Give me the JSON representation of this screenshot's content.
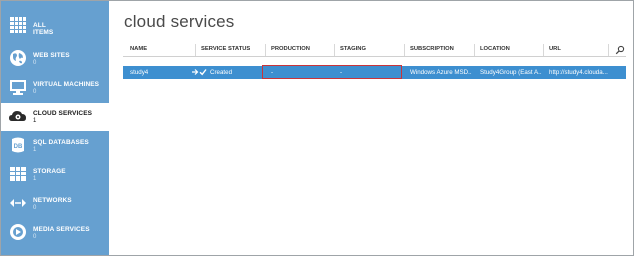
{
  "sidebar": {
    "items": [
      {
        "label": "ALL",
        "label2": "ITEMS",
        "count": "",
        "icon": "grid-icon"
      },
      {
        "label": "WEB SITES",
        "count": "0",
        "icon": "globe-icon"
      },
      {
        "label": "VIRTUAL MACHINES",
        "count": "0",
        "icon": "monitor-icon"
      },
      {
        "label": "CLOUD SERVICES",
        "count": "1",
        "icon": "cloud-gear-icon",
        "active": true
      },
      {
        "label": "SQL DATABASES",
        "count": "1",
        "icon": "database-icon"
      },
      {
        "label": "STORAGE",
        "count": "1",
        "icon": "table-icon"
      },
      {
        "label": "NETWORKS",
        "count": "0",
        "icon": "network-icon"
      },
      {
        "label": "MEDIA SERVICES",
        "count": "0",
        "icon": "media-icon"
      }
    ],
    "colors": {
      "background": "#66a0d0",
      "active": "#ffffff"
    }
  },
  "main": {
    "title": "cloud services",
    "table": {
      "columns": [
        "NAME",
        "SERVICE STATUS",
        "PRODUCTION",
        "STAGING",
        "SUBSCRIPTION",
        "LOCATION",
        "URL"
      ],
      "rows": [
        {
          "name": "study4",
          "status": "Created",
          "production": "-",
          "staging": "-",
          "subscription": "Windows Azure MSD...",
          "location": "Study4Group (East A...",
          "url": "http://study4.clouda..."
        }
      ],
      "selected_row_color": "#3d8fd0",
      "highlight_color": "#c8343a"
    }
  }
}
